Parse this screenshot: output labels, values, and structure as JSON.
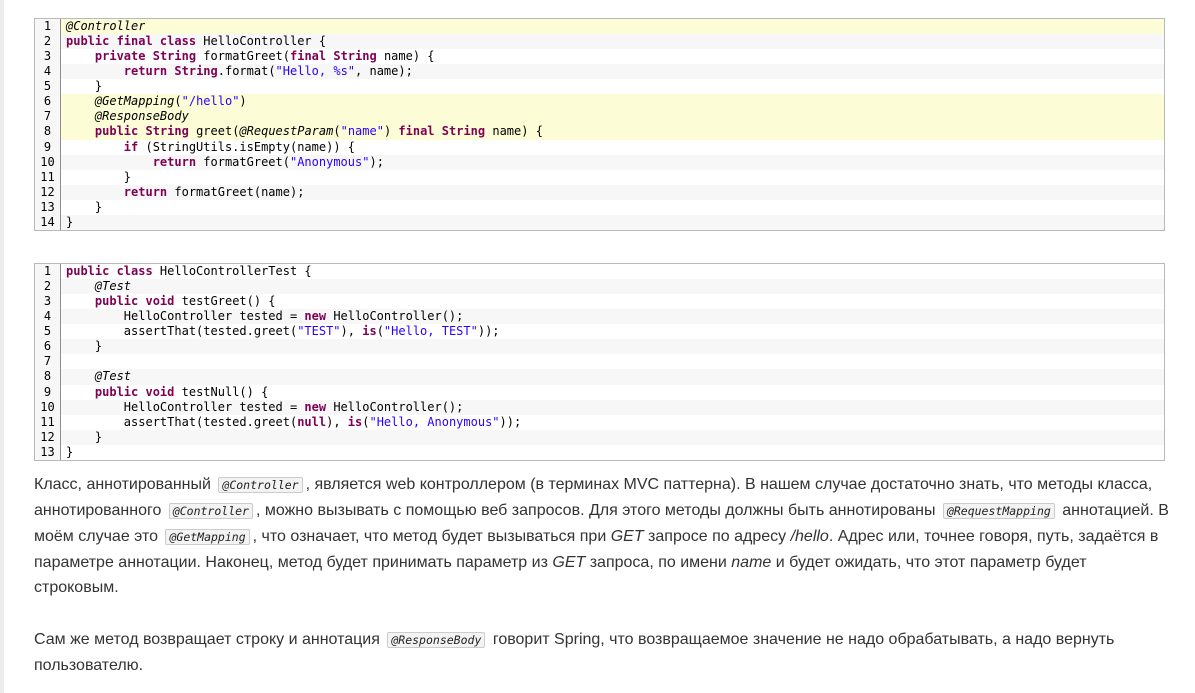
{
  "code_block_1": {
    "lines": [
      {
        "num": "1",
        "hl": true,
        "parts": [
          {
            "t": "@Controller",
            "c": "an"
          }
        ]
      },
      {
        "num": "2",
        "parts": [
          {
            "t": "public final class",
            "c": "kw"
          },
          {
            "t": " HelloController {"
          }
        ]
      },
      {
        "num": "3",
        "parts": [
          {
            "t": "    "
          },
          {
            "t": "private",
            "c": "kw"
          },
          {
            "t": " "
          },
          {
            "t": "String",
            "c": "kw"
          },
          {
            "t": " formatGreet("
          },
          {
            "t": "final",
            "c": "kw"
          },
          {
            "t": " "
          },
          {
            "t": "String",
            "c": "kw"
          },
          {
            "t": " name) {"
          }
        ]
      },
      {
        "num": "4",
        "parts": [
          {
            "t": "        "
          },
          {
            "t": "return",
            "c": "kw"
          },
          {
            "t": " "
          },
          {
            "t": "String",
            "c": "kw"
          },
          {
            "t": ".format("
          },
          {
            "t": "\"Hello, %s\"",
            "c": "st"
          },
          {
            "t": ", name);"
          }
        ]
      },
      {
        "num": "5",
        "parts": [
          {
            "t": "    }"
          }
        ]
      },
      {
        "num": "6",
        "hl": true,
        "parts": [
          {
            "t": "    "
          },
          {
            "t": "@GetMapping",
            "c": "an"
          },
          {
            "t": "("
          },
          {
            "t": "\"/hello\"",
            "c": "st"
          },
          {
            "t": ")"
          }
        ]
      },
      {
        "num": "7",
        "hl": true,
        "parts": [
          {
            "t": "    "
          },
          {
            "t": "@ResponseBody",
            "c": "an"
          }
        ]
      },
      {
        "num": "8",
        "hl": true,
        "parts": [
          {
            "t": "    "
          },
          {
            "t": "public",
            "c": "kw"
          },
          {
            "t": " "
          },
          {
            "t": "String",
            "c": "kw"
          },
          {
            "t": " greet("
          },
          {
            "t": "@RequestParam",
            "c": "an"
          },
          {
            "t": "("
          },
          {
            "t": "\"name\"",
            "c": "st"
          },
          {
            "t": ") "
          },
          {
            "t": "final",
            "c": "kw"
          },
          {
            "t": " "
          },
          {
            "t": "String",
            "c": "kw"
          },
          {
            "t": " name) {"
          }
        ]
      },
      {
        "num": "9",
        "parts": [
          {
            "t": "        "
          },
          {
            "t": "if",
            "c": "kw"
          },
          {
            "t": " (StringUtils.isEmpty(name)) {"
          }
        ]
      },
      {
        "num": "10",
        "parts": [
          {
            "t": "            "
          },
          {
            "t": "return",
            "c": "kw"
          },
          {
            "t": " formatGreet("
          },
          {
            "t": "\"Anonymous\"",
            "c": "st"
          },
          {
            "t": ");"
          }
        ]
      },
      {
        "num": "11",
        "parts": [
          {
            "t": "        }"
          }
        ]
      },
      {
        "num": "12",
        "parts": [
          {
            "t": "        "
          },
          {
            "t": "return",
            "c": "kw"
          },
          {
            "t": " formatGreet(name);"
          }
        ]
      },
      {
        "num": "13",
        "parts": [
          {
            "t": "    }"
          }
        ]
      },
      {
        "num": "14",
        "parts": [
          {
            "t": "}"
          }
        ]
      }
    ]
  },
  "code_block_2": {
    "lines": [
      {
        "num": "1",
        "parts": [
          {
            "t": "public class",
            "c": "kw"
          },
          {
            "t": " HelloControllerTest {"
          }
        ]
      },
      {
        "num": "2",
        "parts": [
          {
            "t": "    "
          },
          {
            "t": "@Test",
            "c": "an"
          }
        ]
      },
      {
        "num": "3",
        "parts": [
          {
            "t": "    "
          },
          {
            "t": "public void",
            "c": "kw"
          },
          {
            "t": " testGreet() {"
          }
        ]
      },
      {
        "num": "4",
        "parts": [
          {
            "t": "        HelloController tested = "
          },
          {
            "t": "new",
            "c": "kw"
          },
          {
            "t": " HelloController();"
          }
        ]
      },
      {
        "num": "5",
        "parts": [
          {
            "t": "        assertThat(tested.greet("
          },
          {
            "t": "\"TEST\"",
            "c": "st"
          },
          {
            "t": "), "
          },
          {
            "t": "is",
            "c": "kw"
          },
          {
            "t": "("
          },
          {
            "t": "\"Hello, TEST\"",
            "c": "st"
          },
          {
            "t": "));"
          }
        ]
      },
      {
        "num": "6",
        "parts": [
          {
            "t": "    }"
          }
        ]
      },
      {
        "num": "7",
        "parts": [
          {
            "t": ""
          }
        ]
      },
      {
        "num": "8",
        "parts": [
          {
            "t": "    "
          },
          {
            "t": "@Test",
            "c": "an"
          }
        ]
      },
      {
        "num": "9",
        "parts": [
          {
            "t": "    "
          },
          {
            "t": "public void",
            "c": "kw"
          },
          {
            "t": " testNull() {"
          }
        ]
      },
      {
        "num": "10",
        "parts": [
          {
            "t": "        HelloController tested = "
          },
          {
            "t": "new",
            "c": "kw"
          },
          {
            "t": " HelloController();"
          }
        ]
      },
      {
        "num": "11",
        "parts": [
          {
            "t": "        assertThat(tested.greet("
          },
          {
            "t": "null",
            "c": "kw"
          },
          {
            "t": "), "
          },
          {
            "t": "is",
            "c": "kw"
          },
          {
            "t": "("
          },
          {
            "t": "\"Hello, Anonymous\"",
            "c": "st"
          },
          {
            "t": "));"
          }
        ]
      },
      {
        "num": "12",
        "parts": [
          {
            "t": "    }"
          }
        ]
      },
      {
        "num": "13",
        "parts": [
          {
            "t": "}"
          }
        ]
      }
    ]
  },
  "paragraph_1": {
    "t1": "Класс, аннотированный",
    "code1": "@Controller",
    "t2": ", является web контроллером (в терминах MVC паттерна). В нашем случае достаточно знать, что методы класса, аннотированного",
    "code2": "@Controller",
    "t3": ", можно вызывать с помощью веб запросов. Для этого методы должны быть аннотированы",
    "code3": "@RequestMapping",
    "t4": "аннотацией. В моём случае это",
    "code4": "@GetMapping",
    "t5": ", что означает, что метод будет вызываться при",
    "em1": "GET",
    "t6": "запросе по адресу",
    "em2": "/hello",
    "t7": ". Адрес или, точнее говоря, путь, задаётся в параметре аннотации. Наконец, метод будет принимать параметр из",
    "em3": "GET",
    "t8": "запроса, по имени",
    "em4": "name",
    "t9": "и будет ожидать, что этот параметр будет строковым."
  },
  "paragraph_2": {
    "t1": "Сам же метод возвращает строку и аннотация",
    "code1": "@ResponseBody",
    "t2": "говорит Spring, что возвращаемое значение не надо обрабатывать, а надо вернуть пользователю."
  }
}
